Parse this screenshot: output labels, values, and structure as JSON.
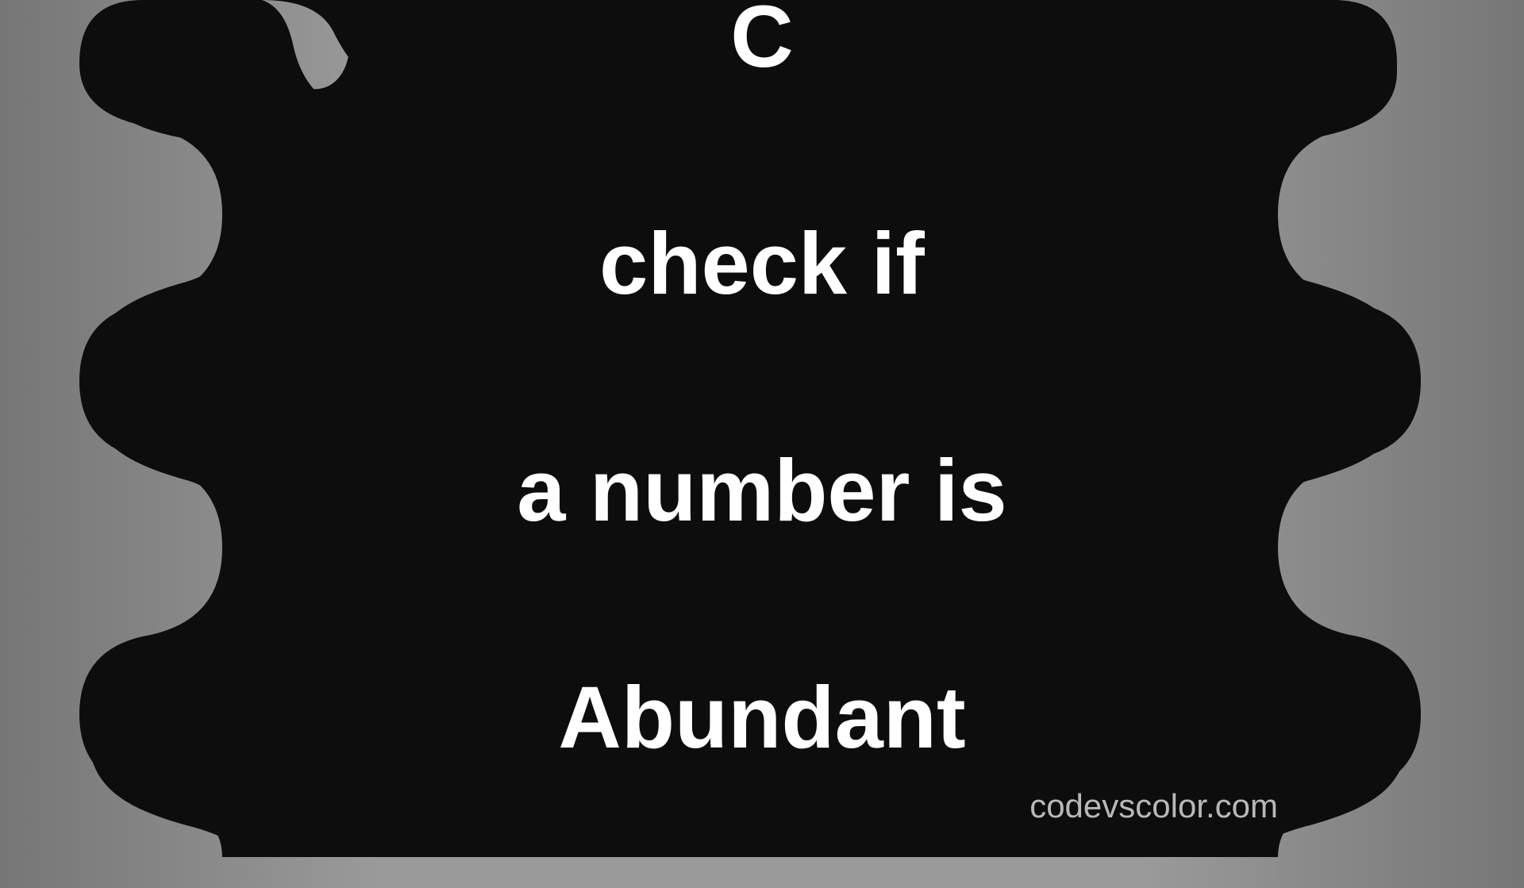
{
  "title": {
    "line1": "C",
    "line2": "check if",
    "line3": "a number is",
    "line4": "Abundant"
  },
  "watermark": "codevscolor.com",
  "colors": {
    "blob": "#0d0d0d",
    "text": "#ffffff",
    "watermark": "#b8b8b8"
  }
}
